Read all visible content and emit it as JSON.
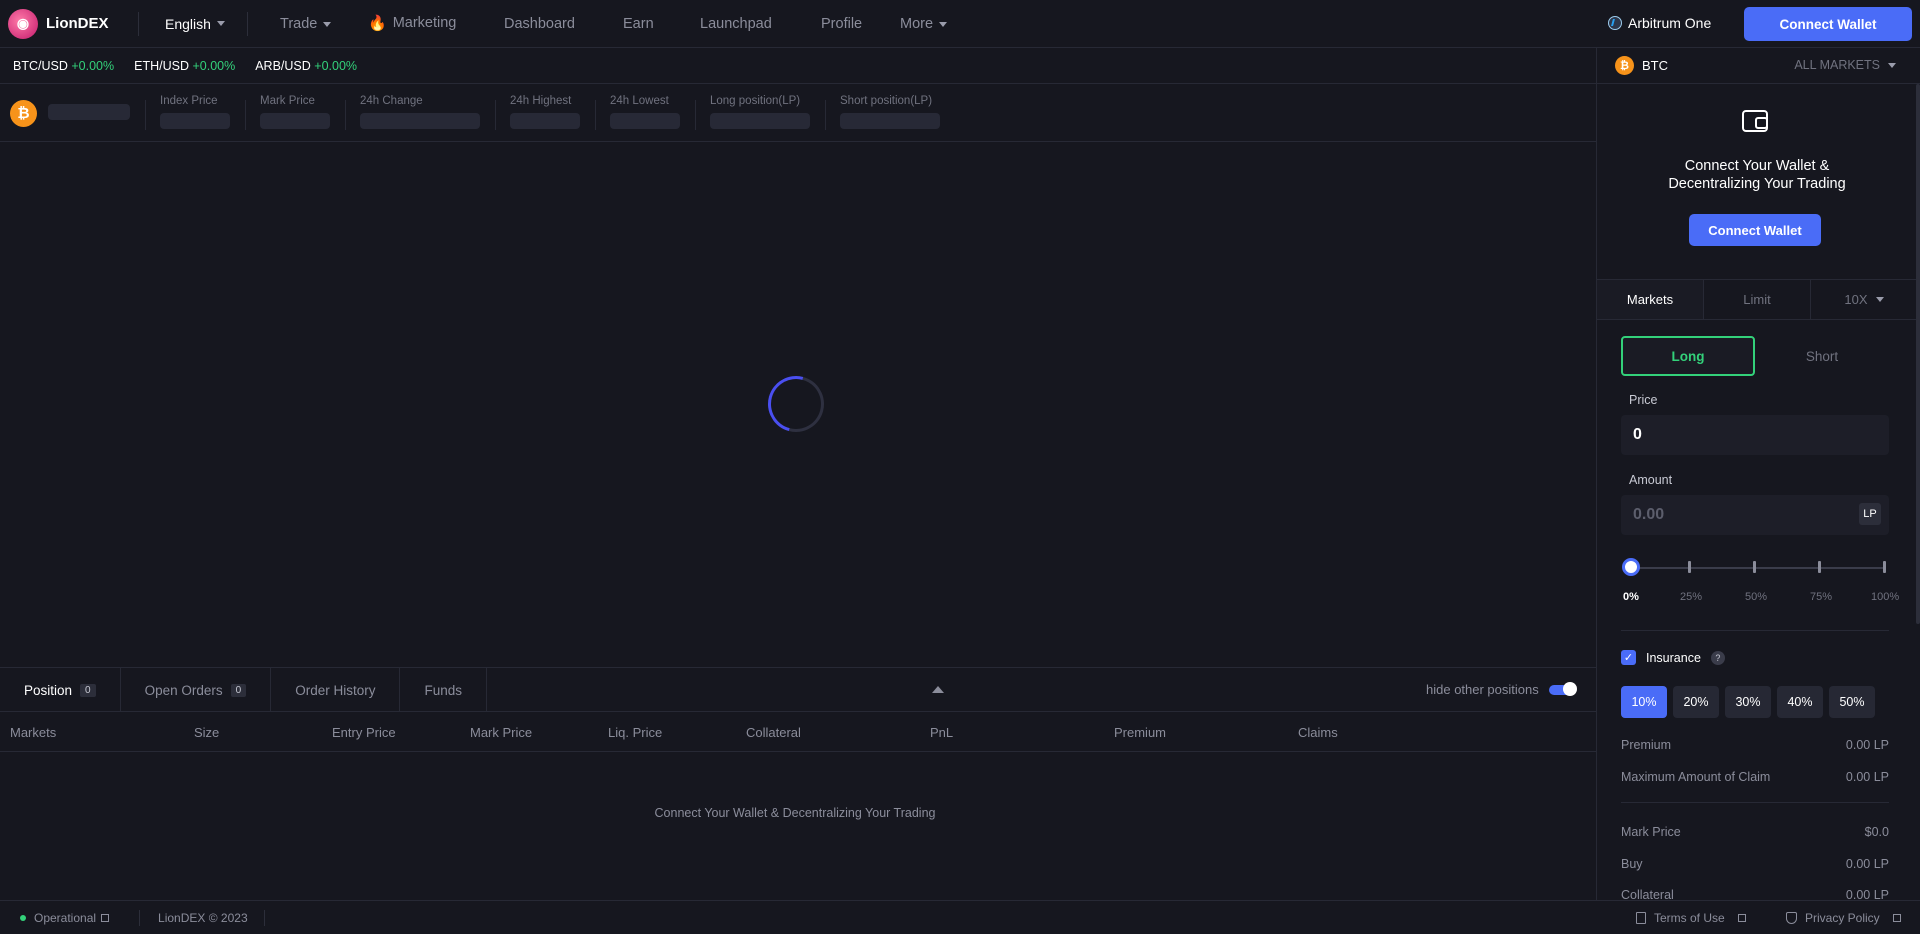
{
  "nav": {
    "logo_text": "LionDEX",
    "language": "English",
    "items": [
      {
        "label": "Trade",
        "dropdown": true
      },
      {
        "label": "Marketing"
      },
      {
        "label": "Dashboard"
      },
      {
        "label": "Earn"
      },
      {
        "label": "Launchpad"
      },
      {
        "label": "Profile"
      },
      {
        "label": "More",
        "dropdown": true
      }
    ],
    "network": "Arbitrum One",
    "connect_label": "Connect Wallet"
  },
  "ticker": [
    {
      "pair": "BTC/USD",
      "change": "+0.00%"
    },
    {
      "pair": "ETH/USD",
      "change": "+0.00%"
    },
    {
      "pair": "ARB/USD",
      "change": "+0.00%"
    }
  ],
  "stats": {
    "coin_symbol": "₿",
    "labels": [
      "Index Price",
      "Mark Price",
      "24h Change",
      "24h Highest",
      "24h Lowest",
      "Long position(LP)",
      "Short position(LP)"
    ]
  },
  "positions": {
    "tabs": [
      {
        "label": "Position",
        "count": "0"
      },
      {
        "label": "Open Orders",
        "count": "0"
      },
      {
        "label": "Order History"
      },
      {
        "label": "Funds"
      }
    ],
    "hide_label": "hide other positions",
    "columns": [
      "Markets",
      "Size",
      "Entry Price",
      "Mark Price",
      "Liq. Price",
      "Collateral",
      "PnL",
      "Premium",
      "Claims"
    ],
    "empty_message": "Connect Your Wallet & Decentralizing Your Trading"
  },
  "footer": {
    "status": "Operational",
    "copyright": "LionDEX © 2023",
    "terms": "Terms of Use",
    "privacy": "Privacy Policy"
  },
  "panel": {
    "symbol": "BTC",
    "all_markets": "ALL MARKETS",
    "wallet_msg_1": "Connect Your Wallet &",
    "wallet_msg_2": "Decentralizing Your Trading",
    "connect_label": "Connect Wallet",
    "tabs": {
      "markets": "Markets",
      "limit": "Limit",
      "leverage": "10X"
    },
    "long": "Long",
    "short": "Short",
    "price_label": "Price",
    "price_value": "0",
    "amount_label": "Amount",
    "amount_placeholder": "0.00",
    "amount_unit": "LP",
    "slider_pcts": [
      "0%",
      "25%",
      "50%",
      "75%",
      "100%"
    ],
    "slider_value": 0,
    "insurance_label": "Insurance",
    "insurance_checked": true,
    "insurance_pcts": [
      "10%",
      "20%",
      "30%",
      "40%",
      "50%"
    ],
    "insurance_selected": "10%",
    "details": [
      {
        "label": "Premium",
        "value": "0.00 LP"
      },
      {
        "label": "Maximum Amount of Claim",
        "value": "0.00 LP"
      },
      {
        "label": "Mark Price",
        "value": "$0.0"
      },
      {
        "label": "Buy",
        "value": "0.00 LP"
      },
      {
        "label": "Collateral",
        "value": "0.00 LP"
      }
    ]
  },
  "colors": {
    "accent": "#4a6cf7",
    "positive": "#33d17a",
    "background": "#16171f"
  }
}
